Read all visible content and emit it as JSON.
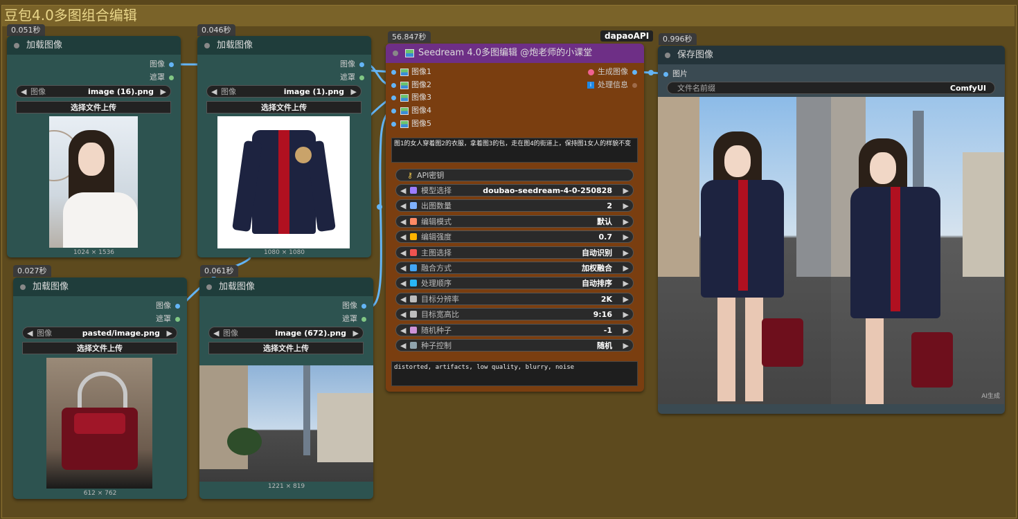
{
  "group": {
    "title": "豆包4.0多图组合编辑"
  },
  "nodes": {
    "load1": {
      "time": "0.051秒",
      "title": "加载图像",
      "out_image": "图像",
      "out_mask": "遮罩",
      "combo_label": "图像",
      "file": "image (16).png",
      "upload": "选择文件上传",
      "dims": "1024 × 1536"
    },
    "load2": {
      "time": "0.046秒",
      "title": "加载图像",
      "out_image": "图像",
      "out_mask": "遮罩",
      "combo_label": "图像",
      "file": "image (1).png",
      "upload": "选择文件上传",
      "dims": "1080 × 1080"
    },
    "load3": {
      "time": "0.027秒",
      "title": "加载图像",
      "out_image": "图像",
      "out_mask": "遮罩",
      "combo_label": "图像",
      "file": "pasted/image.png",
      "upload": "选择文件上传",
      "dims": "612 × 762"
    },
    "load4": {
      "time": "0.061秒",
      "title": "加载图像",
      "out_image": "图像",
      "out_mask": "遮罩",
      "combo_label": "图像",
      "file": "image (672).png",
      "upload": "选择文件上传",
      "dims": "1221 × 819"
    },
    "seedream": {
      "time": "56.847秒",
      "tag": "dapaoAPI",
      "title": "Seedream 4.0多图编辑 @炮老师的小课堂",
      "inputs": [
        "图像1",
        "图像2",
        "图像3",
        "图像4",
        "图像5"
      ],
      "outputs": [
        "生成图像",
        "处理信息"
      ],
      "prompt": "图1的女人穿着图2的衣服，拿着图3的包，走在图4的街道上，保持图1女人的样貌不变",
      "api_key_label": "API密钥",
      "widgets": [
        {
          "name": "模型选择",
          "value": "doubao-seedream-4-0-250828",
          "icon_color": "#9c7cff"
        },
        {
          "name": "出图数量",
          "value": "2",
          "icon_color": "#7fb2ff"
        },
        {
          "name": "编辑模式",
          "value": "默认",
          "icon_color": "#ff8a65"
        },
        {
          "name": "编辑强度",
          "value": "0.7",
          "icon_color": "#ffb300"
        },
        {
          "name": "主图选择",
          "value": "自动识别",
          "icon_color": "#ef5350"
        },
        {
          "name": "融合方式",
          "value": "加权融合",
          "icon_color": "#42a5f5"
        },
        {
          "name": "处理顺序",
          "value": "自动排序",
          "icon_color": "#29b6f6"
        },
        {
          "name": "目标分辨率",
          "value": "2K",
          "icon_color": "#bdbdbd"
        },
        {
          "name": "目标宽高比",
          "value": "9:16",
          "icon_color": "#bdbdbd"
        },
        {
          "name": "随机种子",
          "value": "-1",
          "icon_color": "#ce93d8"
        },
        {
          "name": "种子控制",
          "value": "随机",
          "icon_color": "#90a4ae"
        }
      ],
      "negative_prompt": "distorted, artifacts, low quality, blurry, noise"
    },
    "save": {
      "time": "0.996秒",
      "title": "保存图像",
      "input": "图片",
      "prefix_label": "文件名前缀",
      "prefix_value": "ComfyUI",
      "watermark": "AI生成"
    }
  },
  "colors": {
    "wire": "#64b5f6",
    "node_bg": "#2d5350",
    "group_title": "#7a6329",
    "seedream_bg": "#7a3e10",
    "seedream_title": "#6e2f86"
  }
}
